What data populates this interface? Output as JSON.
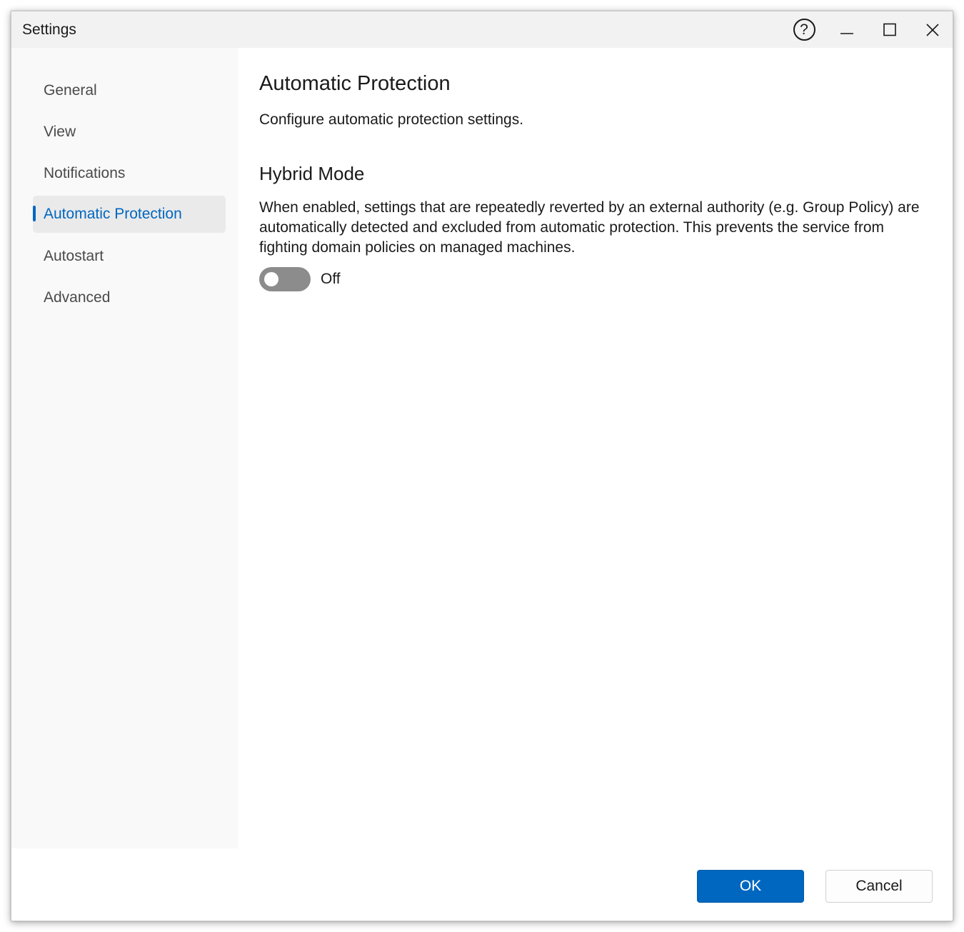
{
  "window": {
    "title": "Settings"
  },
  "titlebar": {
    "help_icon": "question-mark-icon",
    "help_glyph": "?",
    "minimize_icon": "minimize-icon",
    "maximize_icon": "maximize-icon",
    "close_icon": "close-icon"
  },
  "sidebar": {
    "items": [
      {
        "label": "General",
        "selected": false
      },
      {
        "label": "View",
        "selected": false
      },
      {
        "label": "Notifications",
        "selected": false
      },
      {
        "label": "Automatic Protection",
        "selected": true
      },
      {
        "label": "Autostart",
        "selected": false
      },
      {
        "label": "Advanced",
        "selected": false
      }
    ]
  },
  "main": {
    "title": "Automatic Protection",
    "description": "Configure automatic protection settings.",
    "hybrid_mode": {
      "title": "Hybrid Mode",
      "description": "When enabled, settings that are repeatedly reverted by an external authority (e.g. Group Policy) are automatically detected and excluded from automatic protection. This prevents the service from fighting domain policies on managed machines.",
      "toggle_on": false,
      "toggle_label": "Off"
    }
  },
  "footer": {
    "ok_label": "OK",
    "cancel_label": "Cancel"
  },
  "colors": {
    "accent": "#0067c0",
    "sidebar_bg": "#f9f9f9",
    "titlebar_bg": "#f2f2f2",
    "selected_bg": "#eaeaea",
    "toggle_off": "#8c8c8c"
  }
}
